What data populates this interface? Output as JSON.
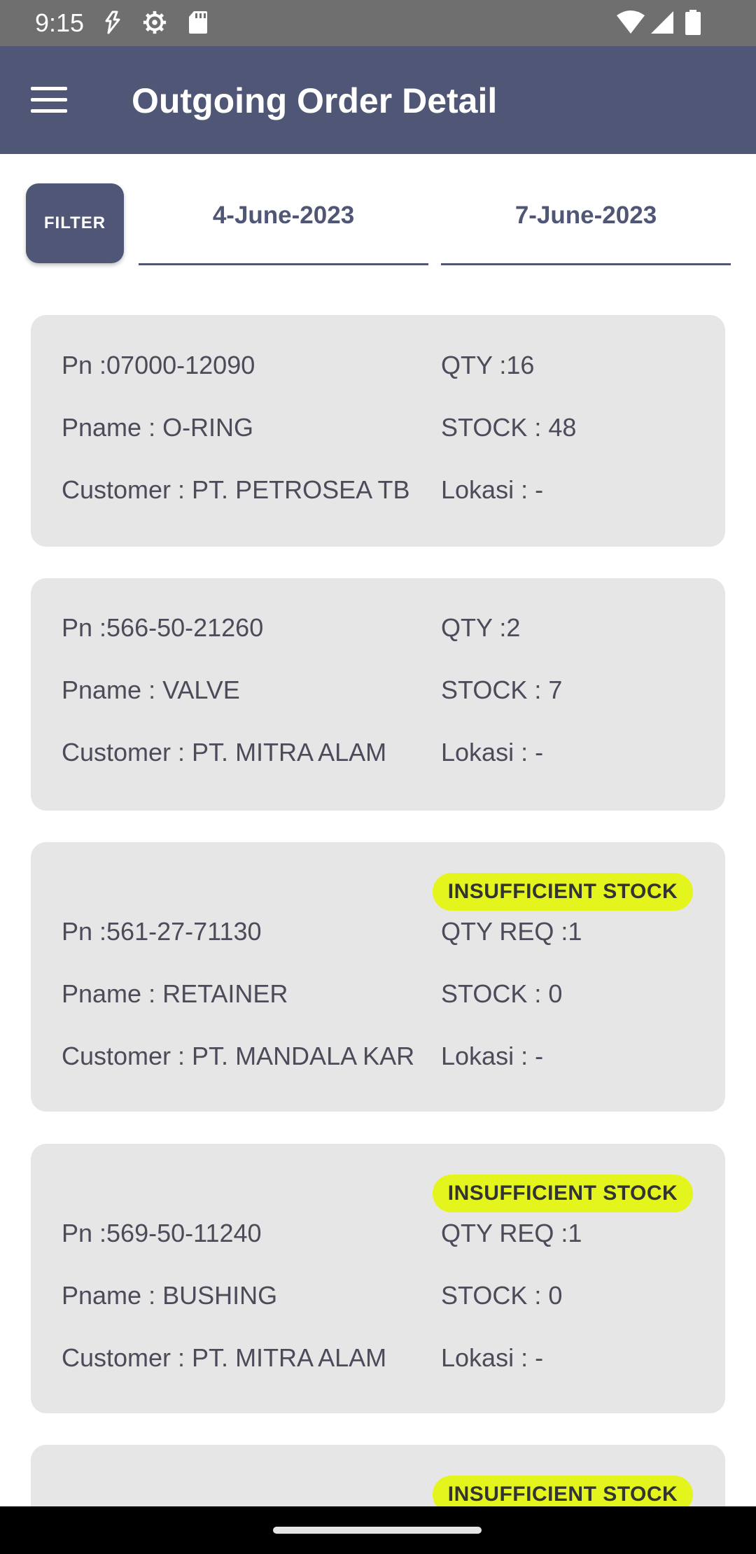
{
  "status_bar": {
    "time": "9:15",
    "left_icons": [
      "data-saver-icon",
      "settings-icon",
      "sd-card-icon"
    ],
    "right_icons": [
      "wifi-icon",
      "signal-icon",
      "battery-icon"
    ]
  },
  "app_bar": {
    "title": "Outgoing Order Detail",
    "background": "#4f5676"
  },
  "filter": {
    "button_label": "FILTER",
    "start_date": "4-June-2023",
    "end_date": "7-June-2023"
  },
  "orders": [
    {
      "pn": "Pn :07000-12090",
      "qty": "QTY :16",
      "pname": "Pname : O-RING",
      "stock": "STOCK : 48",
      "customer": "Customer : PT. PETROSEA TB",
      "lokasi": "Lokasi : -",
      "badge": ""
    },
    {
      "pn": "Pn :566-50-21260",
      "qty": "QTY :2",
      "pname": "Pname : VALVE",
      "stock": "STOCK : 7",
      "customer": "Customer : PT. MITRA ALAM",
      "lokasi": "Lokasi : -",
      "badge": ""
    },
    {
      "pn": "Pn :561-27-71130",
      "qty": "QTY REQ :1",
      "pname": "Pname : RETAINER",
      "stock": "STOCK : 0",
      "customer": "Customer : PT. MANDALA KAR",
      "lokasi": "Lokasi : -",
      "badge": "INSUFFICIENT STOCK"
    },
    {
      "pn": "Pn :569-50-11240",
      "qty": "QTY REQ :1",
      "pname": "Pname : BUSHING",
      "stock": "STOCK : 0",
      "customer": "Customer : PT. MITRA ALAM",
      "lokasi": "Lokasi : -",
      "badge": "INSUFFICIENT STOCK"
    },
    {
      "badge": "INSUFFICIENT STOCK"
    }
  ],
  "colors": {
    "accent": "#4f5676",
    "card": "#e6e6e6",
    "badge": "#e4f51e",
    "text": "#4b4b5a"
  }
}
